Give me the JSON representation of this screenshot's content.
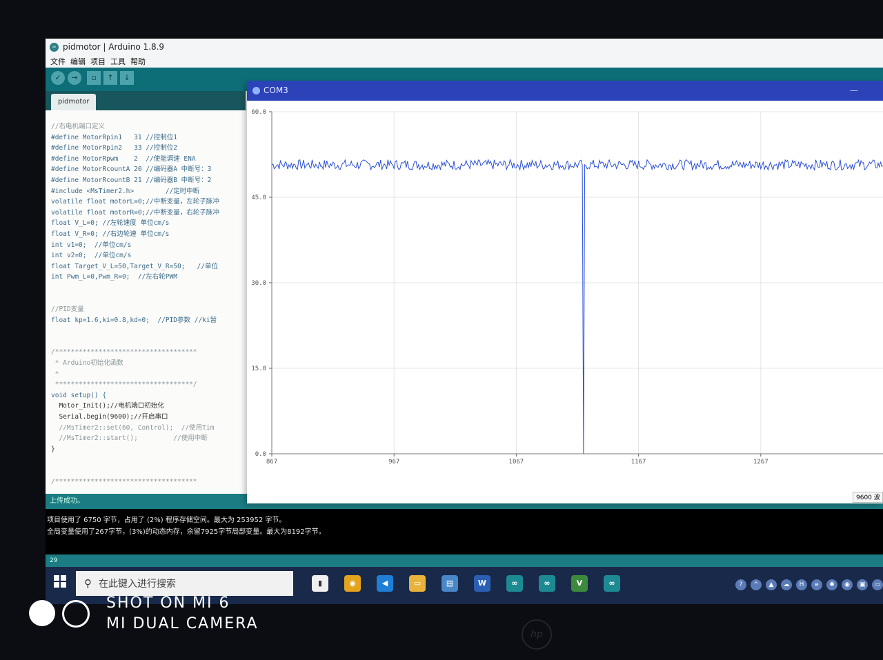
{
  "ide": {
    "title": "pidmotor | Arduino 1.8.9",
    "logo_icon": "∞",
    "menu": [
      "文件",
      "编辑",
      "项目",
      "工具",
      "帮助"
    ],
    "tab": "pidmotor",
    "code": [
      "//右电机端口定义",
      "#define MotorRpin1   31 //控制位1",
      "#define MotorRpin2   33 //控制位2",
      "#define MotorRpwm    2  //使能调速 ENA",
      "#define MotorRcountA 20 //编码器A 中断号：3",
      "#define MotorRcountB 21 //编码器B 中断号：2",
      "#include <MsTimer2.h>        //定时中断",
      "volatile float motorL=0;//中断变量，左轮子脉冲",
      "volatile float motorR=0;//中断变量，右轮子脉冲",
      "float V_L=0; //左轮速度 单位cm/s",
      "float V_R=0; //右边轮速 单位cm/s",
      "int v1=0;  //单位cm/s",
      "int v2=0;  //单位cm/s",
      "float Target_V_L=50,Target_V_R=50;   //单位",
      "int Pwm_L=0,Pwm_R=0;  //左右轮PWM",
      "",
      "",
      "//PID变量",
      "float kp=1.6,ki=0.8,kd=0;  //PID参数 //ki暂",
      "",
      "",
      "/************************************",
      " * Arduino初始化函数",
      " *",
      " ***********************************/",
      "void setup() {",
      "  Motor_Init();//电机端口初始化",
      "  Serial.begin(9600);//开启串口",
      "  //MsTimer2::set(60, Control);  //使用Tim",
      "  //MsTimer2::start();         //使用中断",
      "}",
      "",
      "",
      "/************************************"
    ],
    "status": "上传成功。",
    "console": [
      "项目使用了 6750 字节，占用了 (2%) 程序存储空间。最大为 253952 字节。",
      "全局变量使用了267字节，(3%)的动态内存，余留7925字节局部变量。最大为8192字节。"
    ],
    "line_number": "29"
  },
  "plotter": {
    "title": "COM3",
    "minimize_icon": "—",
    "baud": "9600 波"
  },
  "chart_data": {
    "type": "line",
    "title": "",
    "xlabel": "",
    "ylabel": "",
    "xlim": [
      867,
      1367
    ],
    "ylim": [
      0.0,
      60.0
    ],
    "y_ticks": [
      "60.0",
      "45.0",
      "30.0",
      "15.0",
      "0.0"
    ],
    "x_ticks": [
      "867",
      "967",
      "1067",
      "1167",
      "1267"
    ],
    "grid": true,
    "series": [
      {
        "color": "#2b4fd8",
        "baseline": 50.7,
        "noise_amplitude": 0.9,
        "dip": {
          "x": 1122,
          "y": 0.0
        }
      }
    ]
  },
  "taskbar": {
    "search_placeholder": "在此键入进行搜索",
    "search_icon": "⚲",
    "apps": [
      {
        "name": "notes",
        "label": "▮",
        "color": "#f0f0f0"
      },
      {
        "name": "chrome",
        "label": "◉",
        "color": "#e3a31c"
      },
      {
        "name": "vscode",
        "label": "◀",
        "color": "#1f7fd6"
      },
      {
        "name": "explorer",
        "label": "▭",
        "color": "#e8b33a"
      },
      {
        "name": "calculator",
        "label": "▤",
        "color": "#4a87c8"
      },
      {
        "name": "word",
        "label": "W",
        "color": "#2b5fb3"
      },
      {
        "name": "arduino-1",
        "label": "∞",
        "color": "#1d8a93"
      },
      {
        "name": "arduino-2",
        "label": "∞",
        "color": "#1d8a93"
      },
      {
        "name": "app-v",
        "label": "V",
        "color": "#3d8a3d"
      },
      {
        "name": "arduino-3",
        "label": "∞",
        "color": "#1d8a93"
      }
    ],
    "tray": [
      "?",
      "^",
      "▲",
      "☁",
      "H",
      "e",
      "✱",
      "◉",
      "▣",
      "▭"
    ]
  },
  "watermark": {
    "line1": "SHOT ON MI 6",
    "line2": "MI DUAL CAMERA",
    "laptop_logo": "hp"
  }
}
